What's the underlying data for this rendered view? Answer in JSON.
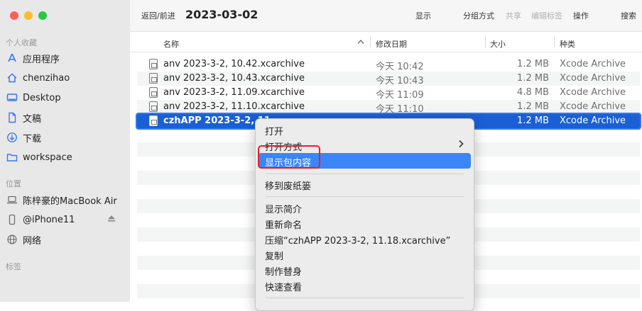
{
  "sidebar": {
    "favorites_label": "个人收藏",
    "favorites": [
      {
        "label": "应用程序",
        "icon": "applications-icon"
      },
      {
        "label": "chenzihao",
        "icon": "home-icon"
      },
      {
        "label": "Desktop",
        "icon": "desktop-icon"
      },
      {
        "label": "文稿",
        "icon": "document-icon"
      },
      {
        "label": "下载",
        "icon": "download-icon"
      },
      {
        "label": "workspace",
        "icon": "folder-icon"
      }
    ],
    "locations_label": "位置",
    "locations": [
      {
        "label": "陈梓豪的MacBook Air",
        "icon": "laptop-icon"
      },
      {
        "label": "@iPhone11",
        "icon": "phone-icon"
      },
      {
        "label": "网络",
        "icon": "network-icon"
      }
    ],
    "tags_label": "标签"
  },
  "toolbar": {
    "nav_label": "返回/前进",
    "title": "2023-03-02",
    "view": "显示",
    "group": "分组方式",
    "share": "共享",
    "edit_tags": "编辑标签",
    "action": "操作",
    "search": "搜索"
  },
  "columns": {
    "name": "名称",
    "date": "修改日期",
    "size": "大小",
    "kind": "种类"
  },
  "files": [
    {
      "name": "anv 2023-3-2, 10.42.xcarchive",
      "date": "今天 10:42",
      "size": "1.2 MB",
      "kind": "Xcode Archive"
    },
    {
      "name": "anv 2023-3-2, 10.43.xcarchive",
      "date": "今天 10:43",
      "size": "1.2 MB",
      "kind": "Xcode Archive"
    },
    {
      "name": "anv 2023-3-2, 11.09.xcarchive",
      "date": "今天 11:09",
      "size": "4.8 MB",
      "kind": "Xcode Archive"
    },
    {
      "name": "anv 2023-3-2, 11.10.xcarchive",
      "date": "今天 11:10",
      "size": "1.2 MB",
      "kind": "Xcode Archive"
    },
    {
      "name": "czhAPP 2023-3-2, 11",
      "date": "",
      "size": "1.2 MB",
      "kind": "Xcode Archive"
    }
  ],
  "menu": {
    "open": "打开",
    "open_with": "打开方式",
    "show_package": "显示包内容",
    "trash": "移到废纸篓",
    "get_info": "显示简介",
    "rename": "重新命名",
    "compress": "压缩“czhAPP 2023-3-2, 11.18.xcarchive”",
    "duplicate": "复制",
    "alias": "制作替身",
    "quick_look": "快速查看"
  },
  "colors": {
    "selection": "#1a5fd4",
    "menu_highlight": "#3b86f7",
    "annotation": "#e81e2a"
  }
}
